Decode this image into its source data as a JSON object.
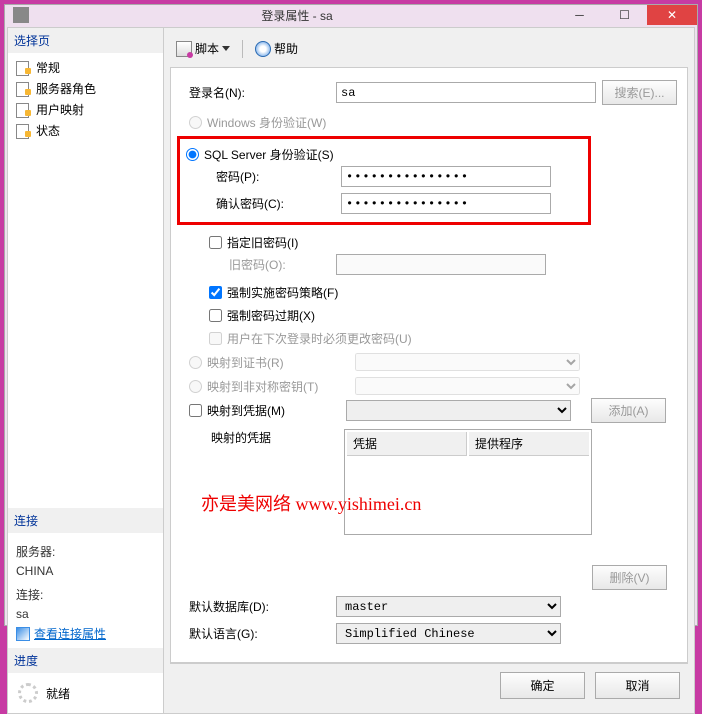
{
  "titlebar": {
    "title": "登录属性 - sa"
  },
  "sidebar": {
    "select_page": "选择页",
    "pages": [
      "常规",
      "服务器角色",
      "用户映射",
      "状态"
    ],
    "connection_header": "连接",
    "server_label": "服务器:",
    "server_value": "CHINA",
    "conn_label": "连接:",
    "conn_value": "sa",
    "view_conn_props": "查看连接属性",
    "progress_header": "进度",
    "ready": "就绪"
  },
  "toolbar": {
    "script": "脚本",
    "help": "帮助"
  },
  "form": {
    "login_label": "登录名(N):",
    "login_value": "sa",
    "search_btn": "搜索(E)...",
    "win_auth": "Windows 身份验证(W)",
    "sql_auth": "SQL Server 身份验证(S)",
    "pwd_label": "密码(P):",
    "pwd_value": "●●●●●●●●●●●●●●●",
    "confirm_label": "确认密码(C):",
    "confirm_value": "●●●●●●●●●●●●●●●",
    "specify_old": "指定旧密码(I)",
    "old_pwd_label": "旧密码(O):",
    "enforce_policy": "强制实施密码策略(F)",
    "enforce_expire": "强制密码过期(X)",
    "must_change": "用户在下次登录时必须更改密码(U)",
    "map_cert": "映射到证书(R)",
    "map_asym": "映射到非对称密钥(T)",
    "map_cred": "映射到凭据(M)",
    "add_btn": "添加(A)",
    "mapped_cred_label": "映射的凭据",
    "cred_col": "凭据",
    "provider_col": "提供程序",
    "del_btn": "删除(V)",
    "default_db_label": "默认数据库(D):",
    "default_db_value": "master",
    "default_lang_label": "默认语言(G):",
    "default_lang_value": "Simplified Chinese"
  },
  "watermark": "亦是美网络 www.yishimei.cn",
  "buttons": {
    "ok": "确定",
    "cancel": "取消"
  }
}
